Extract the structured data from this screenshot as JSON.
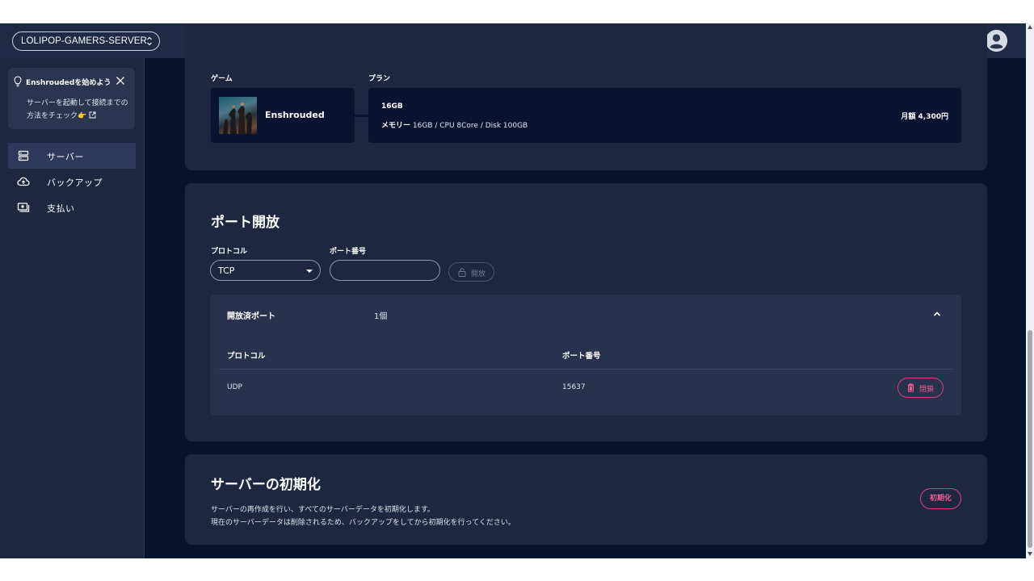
{
  "header": {
    "server_name": "LOLIPOP-GAMERS-SERVER",
    "chevron_icon": "unfold-icon",
    "avatar_icon": "account-circle-icon"
  },
  "sidebar": {
    "tip": {
      "icon": "lightbulb-icon",
      "title": "Enshroudedを始めよう",
      "body": "サーバーを起動して接続までの方法をチェック",
      "emoji": "👉",
      "close_icon": "close-icon",
      "external_icon": "external-link-icon"
    },
    "items": [
      {
        "label": "サーバー",
        "icon": "server-icon",
        "active": true
      },
      {
        "label": "バックアップ",
        "icon": "cloud-upload-icon",
        "active": false
      },
      {
        "label": "支払い",
        "icon": "payment-icon",
        "active": false
      }
    ]
  },
  "summary": {
    "game_label": "ゲーム",
    "plan_label": "プラン",
    "game_name": "Enshrouded",
    "plan_size": "16GB",
    "plan_spec_label": "メモリー",
    "plan_spec": "16GB / CPU 8Core / Disk 100GB",
    "plan_price": "月額 4,300円"
  },
  "ports": {
    "title": "ポート開放",
    "protocol_label": "プロトコル",
    "port_label": "ポート番号",
    "protocol_value": "TCP",
    "port_placeholder": "",
    "open_button": "開放",
    "open_panel": {
      "title": "開放済ポート",
      "count": "1個",
      "columns": [
        "プロトコル",
        "ポート番号"
      ],
      "rows": [
        {
          "protocol": "UDP",
          "port": "15637",
          "action": "閉鎖"
        }
      ]
    }
  },
  "reset": {
    "title": "サーバーの初期化",
    "desc1": "サーバーの再作成を行い、すべてのサーバーデータを初期化します。",
    "desc2": "現在のサーバーデータは削除されるため、バックアップをしてから初期化を行ってください。",
    "button": "初期化"
  },
  "colors": {
    "background": "#06132b",
    "card": "#1d2840",
    "accent_danger": "#f25b98"
  }
}
